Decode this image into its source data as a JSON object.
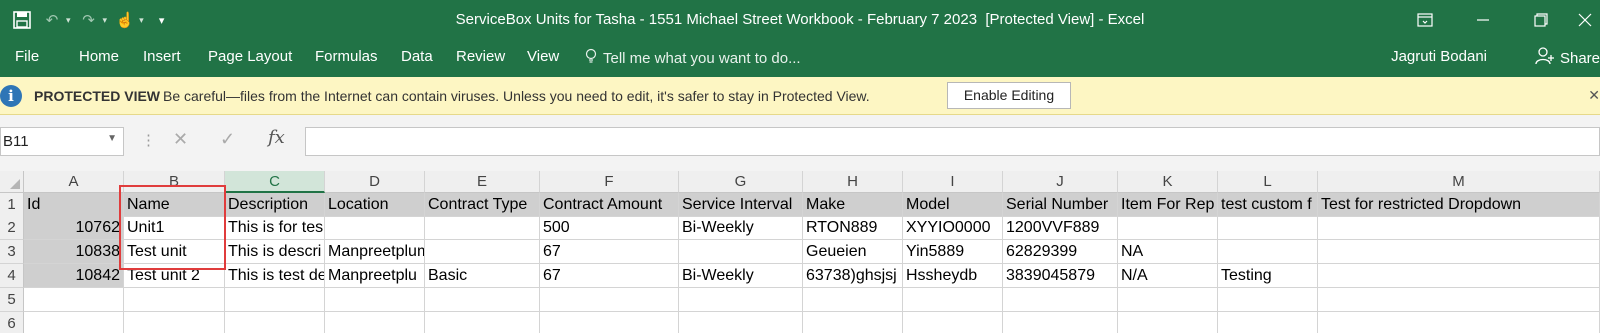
{
  "window": {
    "title": "ServiceBox Units for Tasha - 1551 Michael Street Workbook - February 7 2023  [Protected View] - Excel"
  },
  "ribbon": {
    "file": "File",
    "tabs": [
      "Home",
      "Insert",
      "Page Layout",
      "Formulas",
      "Data",
      "Review",
      "View"
    ],
    "tell_me": "Tell me what you want to do...",
    "user": "Jagruti Bodani",
    "share": "Share"
  },
  "protected_view": {
    "label": "PROTECTED VIEW",
    "message": "Be careful—files from the Internet can contain viruses. Unless you need to edit, it's safer to stay in Protected View.",
    "button": "Enable Editing"
  },
  "formula_bar": {
    "name_box": "B11",
    "formula": ""
  },
  "sheet": {
    "column_letters": [
      "A",
      "B",
      "C",
      "D",
      "E",
      "F",
      "G",
      "H",
      "I",
      "J",
      "K",
      "L",
      "M"
    ],
    "row_numbers": [
      "1",
      "2",
      "3",
      "4",
      "5",
      "6"
    ],
    "headers": [
      "Id",
      "Name",
      "Description",
      "Location",
      "Contract Type",
      "Contract Amount",
      "Service Interval",
      "Make",
      "Model",
      "Serial Number",
      "Item For Rep",
      "test custom f",
      "Test for restricted Dropdown"
    ],
    "rows": [
      [
        "10762",
        "Unit1",
        "This is for tes",
        "",
        "",
        "500",
        "Bi-Weekly",
        "RTON889",
        "XYYIO0000",
        "1200VVF889",
        "",
        "",
        ""
      ],
      [
        "10838",
        "Test unit",
        "This is descri",
        "Manpreetplumbing location",
        "",
        "67",
        "",
        "Geueien",
        "Yin5889",
        "62829399",
        "NA",
        "",
        ""
      ],
      [
        "10842",
        "Test unit 2",
        "This is test de",
        "Manpreetplu",
        "Basic",
        "67",
        "Bi-Weekly",
        "63738)ghsjsj",
        "Hssheydb",
        "3839045879",
        "N/A",
        "Testing",
        ""
      ]
    ]
  }
}
